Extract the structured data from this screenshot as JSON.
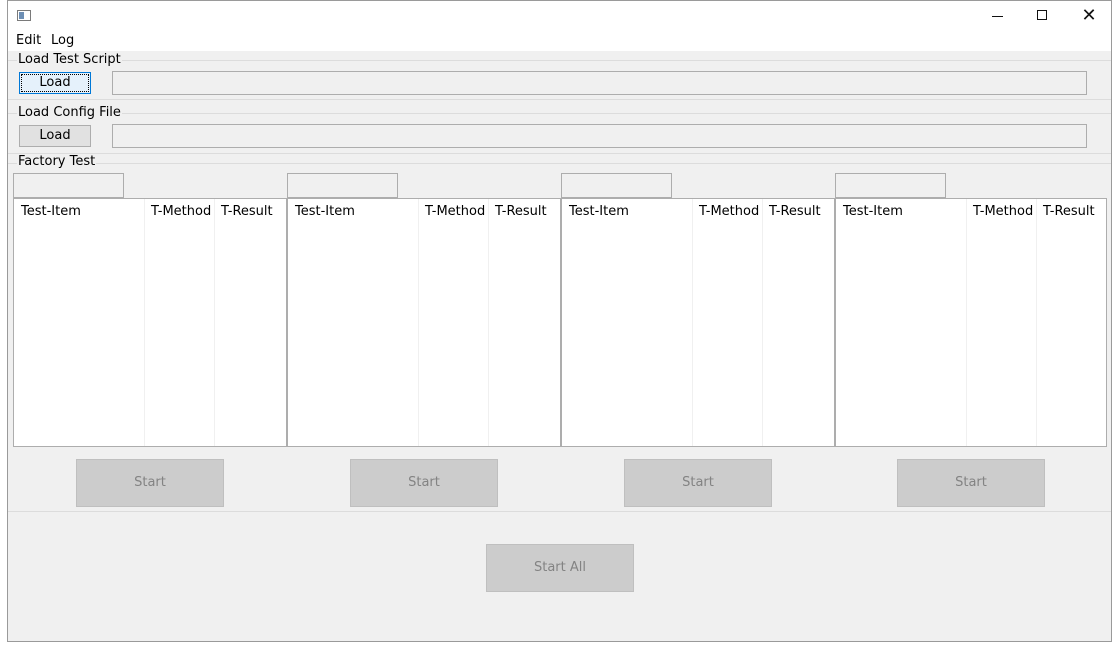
{
  "window": {
    "close_glyph": "✕"
  },
  "menu": [
    "Edit",
    "Log"
  ],
  "load_script": {
    "label": "Load Test Script",
    "button": "Load",
    "path_value": ""
  },
  "load_config": {
    "label": "Load Config File",
    "button": "Load",
    "path_value": ""
  },
  "factory_test": {
    "label": "Factory Test",
    "panels": [
      {
        "id_value": "",
        "columns": [
          "Test-Item",
          "T-Method",
          "T-Result"
        ],
        "start": "Start"
      },
      {
        "id_value": "",
        "columns": [
          "Test-Item",
          "T-Method",
          "T-Result"
        ],
        "start": "Start"
      },
      {
        "id_value": "",
        "columns": [
          "Test-Item",
          "T-Method",
          "T-Result"
        ],
        "start": "Start"
      },
      {
        "id_value": "",
        "columns": [
          "Test-Item",
          "T-Method",
          "T-Result"
        ],
        "start": "Start"
      }
    ],
    "start_all": "Start All"
  },
  "colors": {
    "window_bg": "#f0f0f0",
    "focus_border": "#0078d7",
    "disabled_button": "#cccccc",
    "disabled_text": "#838383"
  }
}
